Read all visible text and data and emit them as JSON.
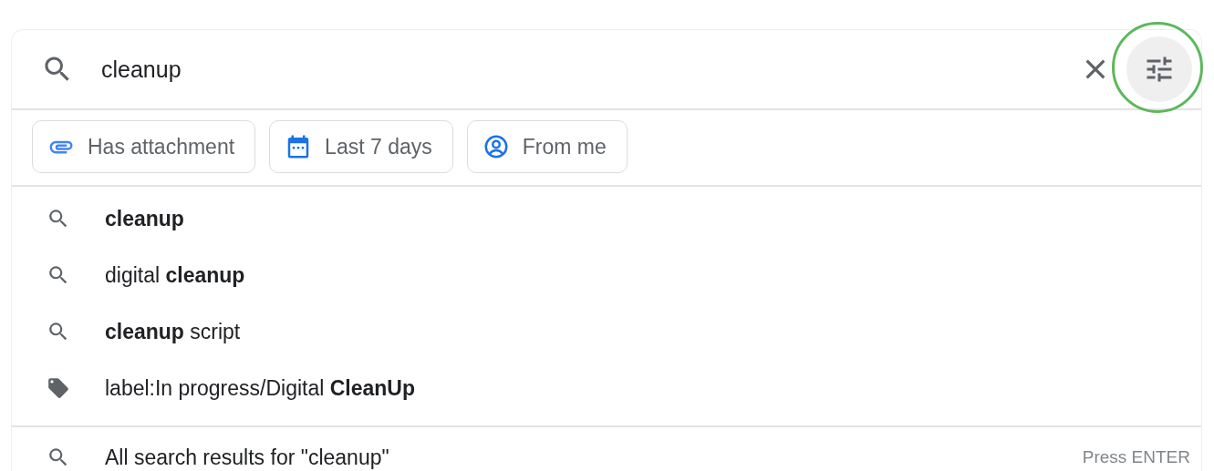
{
  "search": {
    "value": "cleanup",
    "options_highlighted": true
  },
  "chips": [
    {
      "kind": "attachment",
      "label": "Has attachment"
    },
    {
      "kind": "calendar",
      "label": "Last 7 days"
    },
    {
      "kind": "person",
      "label": "From me"
    }
  ],
  "suggestions": [
    {
      "kind": "search",
      "text": "**cleanup**"
    },
    {
      "kind": "search",
      "text": "digital **cleanup**"
    },
    {
      "kind": "search",
      "text": "**cleanup** script"
    },
    {
      "kind": "label",
      "text": "label:In progress/Digital **CleanUp**"
    }
  ],
  "all_results": {
    "text": "All search results for \"cleanup\"",
    "hint": "Press ENTER"
  }
}
